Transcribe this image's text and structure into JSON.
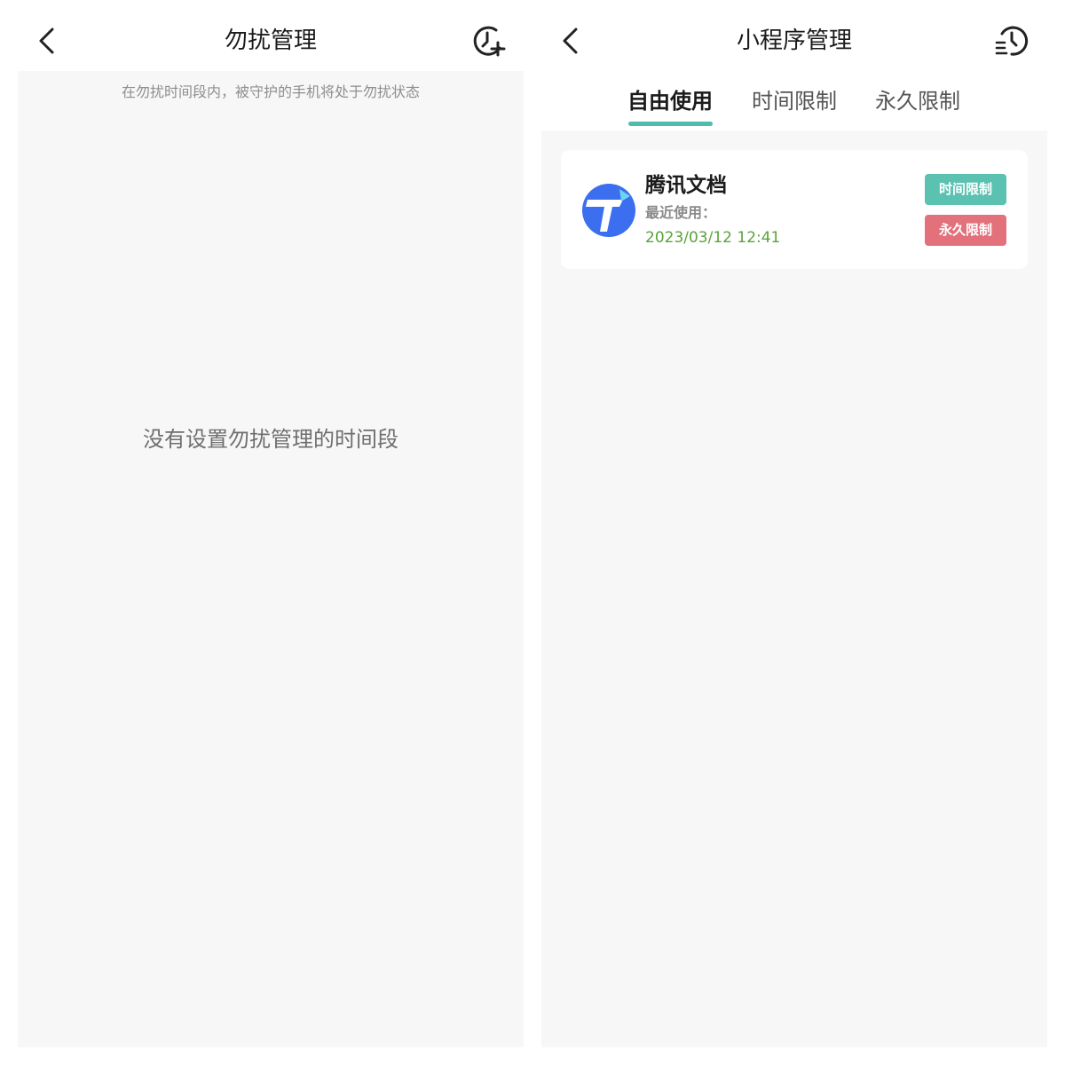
{
  "left_screen": {
    "title": "勿扰管理",
    "back_icon": "chevron-left-icon",
    "action_icon": "clock-add-icon",
    "hint": "在勿扰时间段内，被守护的手机将处于勿扰状态",
    "empty_message": "没有设置勿扰管理的时间段"
  },
  "right_screen": {
    "title": "小程序管理",
    "back_icon": "chevron-left-icon",
    "action_icon": "history-icon",
    "tabs": [
      {
        "label": "自由使用",
        "active": true
      },
      {
        "label": "时间限制",
        "active": false
      },
      {
        "label": "永久限制",
        "active": false
      }
    ],
    "items": [
      {
        "icon": "tencent-docs-icon",
        "name": "腾讯文档",
        "last_used_label": "最近使用：",
        "last_used_time": "2023/03/12 12:41",
        "actions": [
          {
            "label": "时间限制",
            "color": "#5bc2b1"
          },
          {
            "label": "永久限制",
            "color": "#e3717c"
          }
        ]
      }
    ]
  },
  "colors": {
    "accent": "#4dbcad",
    "time_green": "#5aa33a",
    "background_grey": "#f7f7f7"
  }
}
